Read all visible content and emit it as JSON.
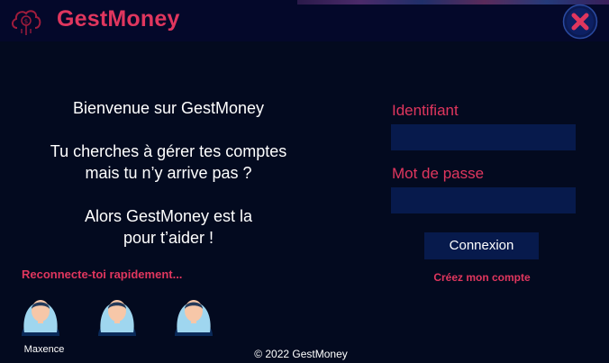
{
  "app": {
    "title": "GestMoney"
  },
  "welcome": {
    "line1": "Bienvenue sur GestMoney",
    "line2": "Tu cherches à gérer tes comptes",
    "line3": "mais tu n’y arrive pas ?",
    "line4": "Alors GestMoney est la",
    "line5": "pour t’aider !"
  },
  "login": {
    "identifiant_label": "Identifiant",
    "identifiant_value": "",
    "password_label": "Mot de passe",
    "password_value": "",
    "connect_button": "Connexion",
    "create_account_link": "Créez mon compte"
  },
  "quick_reconnect": {
    "label": "Reconnecte-toi rapidement...",
    "accounts": [
      {
        "name": "Maxence"
      },
      {
        "name": ""
      },
      {
        "name": ""
      }
    ]
  },
  "footer": {
    "text": "© 2022 GestMoney"
  },
  "icons": {
    "logo": "money-cloud-icon",
    "close": "close-x-icon",
    "avatar": "user-avatar-icon"
  },
  "colors": {
    "background": "#030a1f",
    "titlebar": "#04082a",
    "accent": "#e0365e",
    "input_bg": "#071a4c",
    "text": "#ffffff"
  }
}
